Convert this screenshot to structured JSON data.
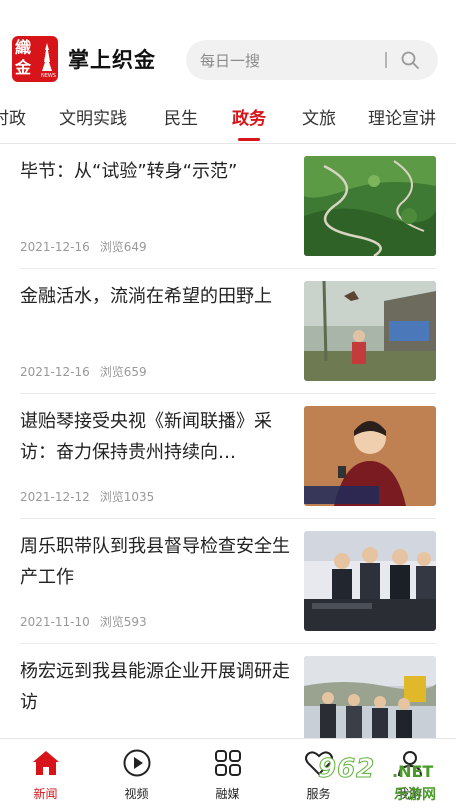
{
  "header": {
    "logo_glyph_top": "織",
    "logo_glyph_bottom": "金",
    "logo_tag": "NEWS",
    "app_title": "掌上织金",
    "search_placeholder": "每日一搜"
  },
  "tabs": [
    {
      "label": "时政"
    },
    {
      "label": "文明实践"
    },
    {
      "label": "民生"
    },
    {
      "label": "政务",
      "active": true
    },
    {
      "label": "文旅"
    },
    {
      "label": "理论宣讲"
    }
  ],
  "articles": [
    {
      "title": "毕节：从“试验”转身“示范”",
      "date": "2021-12-16",
      "views": "浏览649"
    },
    {
      "title": "金融活水，流淌在希望的田野上",
      "date": "2021-12-16",
      "views": "浏览659"
    },
    {
      "title": "谌贻琴接受央视《新闻联播》采访：奋力保持贵州持续向…",
      "date": "2021-12-12",
      "views": "浏览1035"
    },
    {
      "title": "周乐职带队到我县督导检查安全生产工作",
      "date": "2021-11-10",
      "views": "浏览593"
    },
    {
      "title": "杨宏远到我县能源企业开展调研走访",
      "date": "",
      "views": ""
    }
  ],
  "bottom_nav": [
    {
      "label": "新闻",
      "icon": "home-icon",
      "active": true
    },
    {
      "label": "视频",
      "icon": "play-icon"
    },
    {
      "label": "融媒",
      "icon": "grid-icon"
    },
    {
      "label": "服务",
      "icon": "heart-icon"
    },
    {
      "label": "我的",
      "icon": "user-icon"
    }
  ],
  "watermark": {
    "num": "962",
    "net": ".NET",
    "cn": "乐游网"
  },
  "colors": {
    "accent": "#d6141a",
    "text": "#222222",
    "meta": "#999999",
    "search_bg": "#f1f1f1",
    "watermark_green": "#4a9a2a"
  }
}
